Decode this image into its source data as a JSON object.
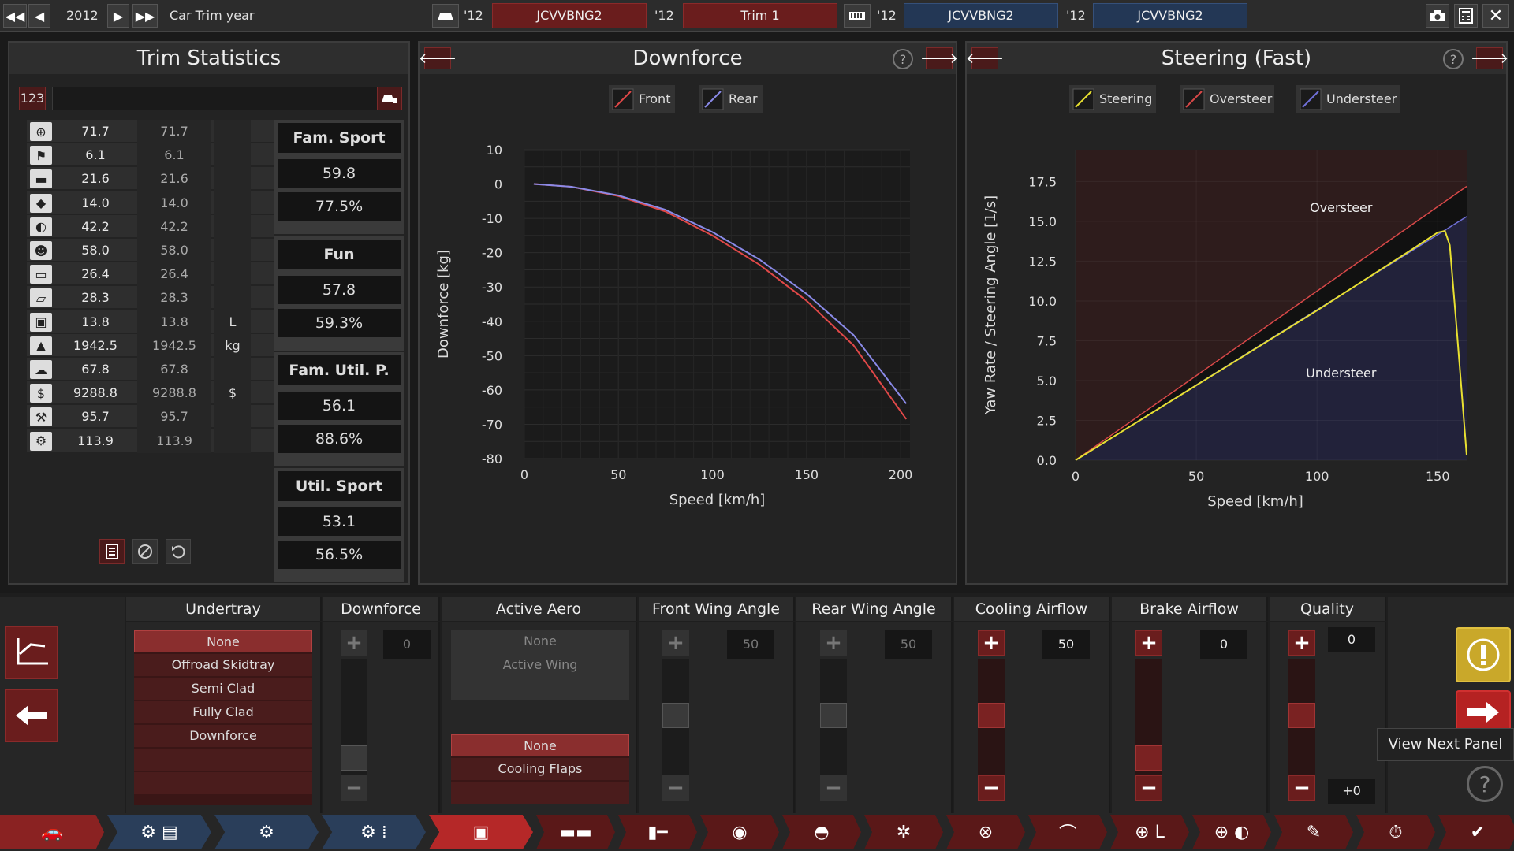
{
  "topbar": {
    "year": "2012",
    "year_label": "Car Trim year",
    "car1_year": "'12",
    "car1_name": "JCVVBNG2",
    "trim1_year": "'12",
    "trim1_name": "Trim 1",
    "car2_year": "'12",
    "car2_name": "JCVVBNG2",
    "car3_year": "'12",
    "car3_name": "JCVVBNG2"
  },
  "stats_panel": {
    "title": "Trim Statistics",
    "number_badge": "123",
    "rows": [
      {
        "icon": "steering-wheel-icon",
        "v1": "71.7",
        "v2": "71.7",
        "unit": ""
      },
      {
        "icon": "checkered-flag-icon",
        "v1": "6.1",
        "v2": "6.1",
        "unit": ""
      },
      {
        "icon": "seat-icon",
        "v1": "21.6",
        "v2": "21.6",
        "unit": ""
      },
      {
        "icon": "diamond-icon",
        "v1": "14.0",
        "v2": "14.0",
        "unit": ""
      },
      {
        "icon": "safety-icon",
        "v1": "42.2",
        "v2": "42.2",
        "unit": ""
      },
      {
        "icon": "passengers-icon",
        "v1": "58.0",
        "v2": "58.0",
        "unit": ""
      },
      {
        "icon": "cargo-icon",
        "v1": "26.4",
        "v2": "26.4",
        "unit": ""
      },
      {
        "icon": "offroad-icon",
        "v1": "28.3",
        "v2": "28.3",
        "unit": ""
      },
      {
        "icon": "fuel-icon",
        "v1": "13.8",
        "v2": "13.8",
        "unit": "L"
      },
      {
        "icon": "weight-icon",
        "v1": "1942.5",
        "v2": "1942.5",
        "unit": "kg"
      },
      {
        "icon": "environment-icon",
        "v1": "67.8",
        "v2": "67.8",
        "unit": ""
      },
      {
        "icon": "cost-icon",
        "v1": "9288.8",
        "v2": "9288.8",
        "unit": "$"
      },
      {
        "icon": "service-icon",
        "v1": "95.7",
        "v2": "95.7",
        "unit": ""
      },
      {
        "icon": "engineering-icon",
        "v1": "113.9",
        "v2": "113.9",
        "unit": ""
      }
    ],
    "scores": [
      {
        "name": "Fam. Sport",
        "value": "59.8",
        "percent": "77.5%"
      },
      {
        "name": "Fun",
        "value": "57.8",
        "percent": "59.3%"
      },
      {
        "name": "Fam. Util. P.",
        "value": "56.1",
        "percent": "88.6%"
      },
      {
        "name": "Util. Sport",
        "value": "53.1",
        "percent": "56.5%"
      }
    ]
  },
  "downforce_panel": {
    "title": "Downforce",
    "legend_front": "Front",
    "legend_rear": "Rear",
    "colors": {
      "front": "#e04848",
      "rear": "#8a8ae8"
    }
  },
  "steering_panel": {
    "title": "Steering (Fast)",
    "legend_steering": "Steering",
    "legend_oversteer": "Oversteer",
    "legend_understeer": "Understeer",
    "region_oversteer": "Oversteer",
    "region_understeer": "Understeer",
    "colors": {
      "steering": "#e8e030",
      "oversteer": "#d84848",
      "understeer": "#7070d8"
    }
  },
  "chart_data": [
    {
      "type": "line",
      "title": "Downforce",
      "xlabel": "Speed [km/h]",
      "ylabel": "Downforce [kg]",
      "xlim": [
        0,
        205
      ],
      "ylim": [
        -80,
        10
      ],
      "xticks": [
        0,
        50,
        100,
        150,
        200
      ],
      "yticks": [
        10,
        0,
        -10,
        -20,
        -30,
        -40,
        -50,
        -60,
        -70,
        -80
      ],
      "grid": true,
      "legend": "top-center",
      "x": [
        5,
        25,
        50,
        75,
        100,
        125,
        150,
        175,
        203
      ],
      "series": [
        {
          "name": "Front",
          "values": [
            0,
            -0.8,
            -3.5,
            -8,
            -15,
            -23.5,
            -34,
            -47,
            -68.5
          ]
        },
        {
          "name": "Rear",
          "values": [
            0,
            -0.8,
            -3.3,
            -7.5,
            -14,
            -22,
            -32,
            -44,
            -64
          ]
        }
      ]
    },
    {
      "type": "line",
      "title": "Steering (Fast)",
      "xlabel": "Speed [km/h]",
      "ylabel": "Yaw Rate / Steering Angle [1/s]",
      "xlim": [
        0,
        162
      ],
      "ylim": [
        0,
        19.5
      ],
      "xticks": [
        0,
        50,
        100,
        150
      ],
      "yticks": [
        0.0,
        2.5,
        5.0,
        7.5,
        10.0,
        12.5,
        15.0,
        17.5
      ],
      "grid": true,
      "legend": "top-center",
      "series": [
        {
          "name": "Steering",
          "x": [
            0,
            50,
            100,
            140,
            150,
            153,
            155,
            158,
            162
          ],
          "values": [
            0,
            4.7,
            9.4,
            13.3,
            14.3,
            14.4,
            13.5,
            8.0,
            0.3
          ]
        },
        {
          "name": "Oversteer",
          "x": [
            0,
            162
          ],
          "values": [
            0,
            17.2
          ]
        },
        {
          "name": "Understeer",
          "x": [
            0,
            162
          ],
          "values": [
            0,
            15.3
          ]
        }
      ]
    }
  ],
  "bottom": {
    "columns": {
      "undertray": "Undertray",
      "downforce": "Downforce",
      "active_aero": "Active Aero",
      "front_wing": "Front Wing Angle",
      "rear_wing": "Rear Wing Angle",
      "cooling": "Cooling Airflow",
      "brake": "Brake Airflow",
      "quality": "Quality"
    },
    "undertray_options": [
      "None",
      "Offroad Skidtray",
      "Semi Clad",
      "Fully Clad",
      "Downforce"
    ],
    "active_wing_options": [
      "None",
      "Active Wing"
    ],
    "cooling_flap_options": [
      "None",
      "Cooling Flaps"
    ],
    "values": {
      "downforce": "0",
      "front_wing": "50",
      "rear_wing": "50",
      "cooling": "50",
      "brake": "0",
      "quality": "0",
      "quality_delta": "+0"
    },
    "tooltip": "View Next Panel"
  }
}
